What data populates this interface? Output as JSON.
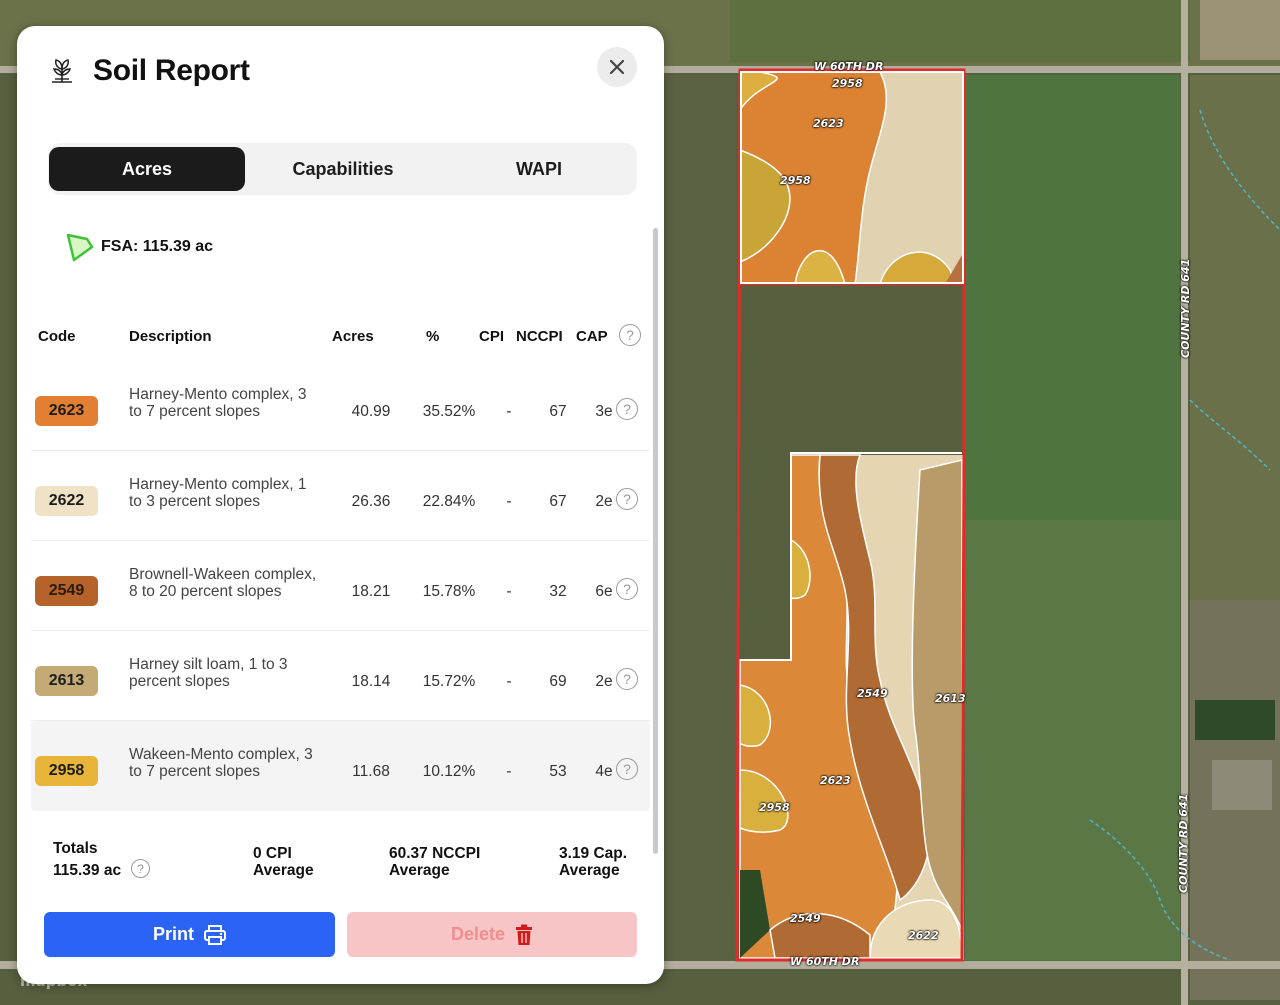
{
  "panel": {
    "title": "Soil Report",
    "app_icon": "plant-sprout-icon",
    "close_icon": "close-icon"
  },
  "tabs": [
    {
      "label": "Acres",
      "active": true
    },
    {
      "label": "Capabilities",
      "active": false
    },
    {
      "label": "WAPI",
      "active": false
    }
  ],
  "fsa": {
    "label": "FSA: 115.39 ac",
    "icon": "field-boundary-icon"
  },
  "table": {
    "headers": {
      "code": "Code",
      "description": "Description",
      "acres": "Acres",
      "percent": "%",
      "cpi": "CPI",
      "nccpi": "NCCPI",
      "cap": "CAP"
    },
    "rows": [
      {
        "code": "2623",
        "color": "#e37f33",
        "description": "Harney-Mento complex, 3 to 7 percent slopes",
        "acres": "40.99",
        "percent": "35.52%",
        "cpi": "-",
        "nccpi": "67",
        "cap": "3e"
      },
      {
        "code": "2622",
        "color": "#f0e2c6",
        "description": "Harney-Mento complex, 1 to 3 percent slopes",
        "acres": "26.36",
        "percent": "22.84%",
        "cpi": "-",
        "nccpi": "67",
        "cap": "2e"
      },
      {
        "code": "2549",
        "color": "#b5622b",
        "description": "Brownell-Wakeen complex, 8 to 20 percent slopes",
        "acres": "18.21",
        "percent": "15.78%",
        "cpi": "-",
        "nccpi": "32",
        "cap": "6e"
      },
      {
        "code": "2613",
        "color": "#c4aa75",
        "description": "Harney silt loam, 1 to 3 percent slopes",
        "acres": "18.14",
        "percent": "15.72%",
        "cpi": "-",
        "nccpi": "69",
        "cap": "2e"
      },
      {
        "code": "2958",
        "color": "#e8b53a",
        "description": "Wakeen-Mento complex, 3 to 7 percent slopes",
        "acres": "11.68",
        "percent": "10.12%",
        "cpi": "-",
        "nccpi": "53",
        "cap": "4e"
      }
    ]
  },
  "totals": {
    "label": "Totals",
    "acres": "115.39 ac",
    "cpi": "0 CPI",
    "cpi_sub": "Average",
    "nccpi": "60.37 NCCPI",
    "nccpi_sub": "Average",
    "cap": "3.19 Cap.",
    "cap_sub": "Average"
  },
  "buttons": {
    "print": "Print",
    "delete": "Delete"
  },
  "map": {
    "roads": {
      "top": "W 60TH DR",
      "bottom": "W 60TH DR",
      "right_upper": "COUNTY RD 641",
      "right_lower": "COUNTY RD 641"
    },
    "soil_labels": {
      "north_a": "2958",
      "north_b": "2623",
      "north_c": "2958",
      "south_a": "2549",
      "south_b": "2613",
      "south_c": "2623",
      "south_d": "2958",
      "south_e": "2549",
      "south_f": "2622"
    },
    "attribution": "mapbox"
  }
}
